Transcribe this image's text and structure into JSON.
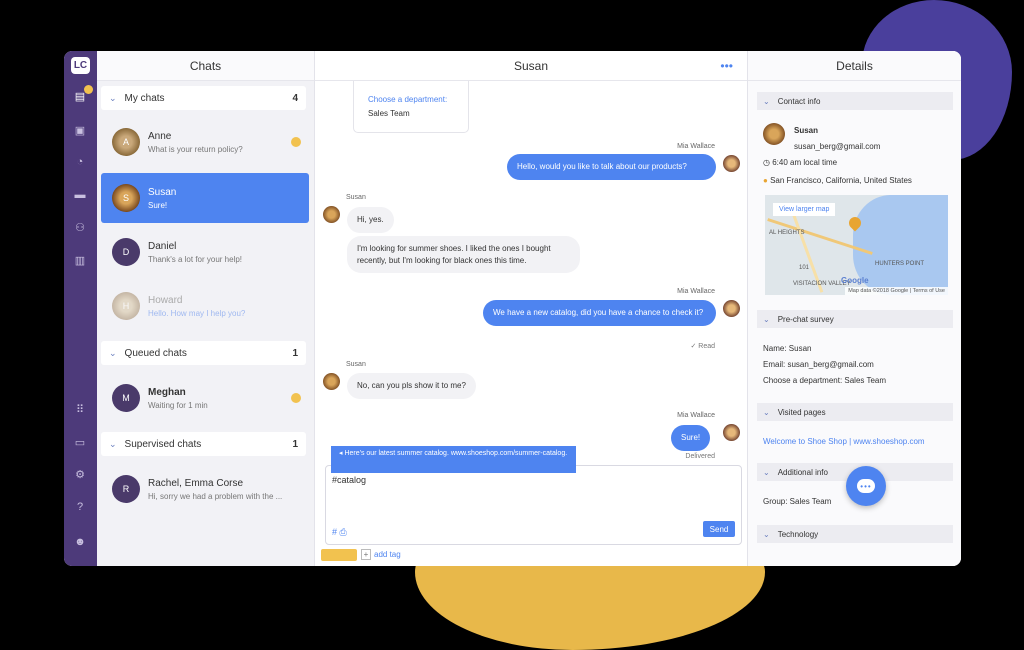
{
  "app": {
    "logo": "LC"
  },
  "rail": {
    "icons": [
      "chats-icon",
      "contacts-icon",
      "clock-icon",
      "archive-icon",
      "team-icon",
      "reports-icon",
      "apps-icon",
      "billing-icon",
      "settings-icon",
      "help-icon",
      "profile-icon"
    ]
  },
  "chats": {
    "title": "Chats",
    "my_chats": {
      "label": "My chats",
      "count": "4"
    },
    "queued": {
      "label": "Queued chats",
      "count": "1"
    },
    "supervised": {
      "label": "Supervised chats",
      "count": "1"
    },
    "items": [
      {
        "name": "Anne",
        "message": "What is your return policy?",
        "initial": "A"
      },
      {
        "name": "Susan",
        "message": "Sure!",
        "initial": "S"
      },
      {
        "name": "Daniel",
        "message": "Thank's a lot for your help!",
        "initial": "D"
      },
      {
        "name": "Howard",
        "message": "Hello. How may I help you?",
        "initial": "H"
      },
      {
        "name": "Meghan",
        "message": "Waiting for 1 min",
        "initial": "M"
      },
      {
        "name": "Rachel, Emma Corse",
        "message": "Hi, sorry we had a problem with the ...",
        "initial": "R"
      }
    ]
  },
  "conversation": {
    "title": "Susan",
    "dept_card": {
      "label": "Choose a department:",
      "value": "Sales Team"
    },
    "messages": [
      {
        "sender": "Mia Wallace",
        "text": "Hello, would you like to talk about our products?"
      },
      {
        "sender": "Susan",
        "text": "Hi, yes."
      },
      {
        "sender": "",
        "text": "I'm looking for summer shoes. I liked the ones I bought recently, but I'm looking for black ones this time."
      },
      {
        "sender": "Mia Wallace",
        "text": "We have a new catalog, did you have a chance to check it?",
        "status": "✓ Read"
      },
      {
        "sender": "Susan",
        "text": "No, can you pls show it to me?"
      },
      {
        "sender": "Mia Wallace",
        "text": "Sure!",
        "status": "Delivered"
      }
    ],
    "suggestion": "◂ Here's our latest summer catalog. www.shoeshop.com/summer-catalog.",
    "composer_value": "#catalog",
    "send_label": "Send",
    "tools": "# ⎙",
    "add_tag": "add tag",
    "plus": "+"
  },
  "details": {
    "title": "Details",
    "contact_info": {
      "label": "Contact info",
      "name": "Susan",
      "email": "susan_berg@gmail.com",
      "time": "6:40 am local time",
      "location": "San Francisco, California, United States",
      "map_link": "View larger map",
      "map_footer": "Map data ©2018 Google | Terms of Use",
      "map_logo": "Google",
      "map_labels": [
        "AL HEIGHTS",
        "HUNTERS POINT",
        "VISITACION VALLEY",
        "101"
      ]
    },
    "pre_chat": {
      "label": "Pre-chat survey",
      "name": "Name: Susan",
      "email": "Email: susan_berg@gmail.com",
      "dept": "Choose a department: Sales Team"
    },
    "visited": {
      "label": "Visited pages",
      "link": "Welcome to Shoe Shop | www.shoeshop.com"
    },
    "additional": {
      "label": "Additional info",
      "group": "Group: Sales Team"
    },
    "technology": {
      "label": "Technology"
    }
  },
  "colors": {
    "accent": "#4e84f0",
    "rail": "#4d3a7a",
    "highlight": "#f2c24f"
  }
}
